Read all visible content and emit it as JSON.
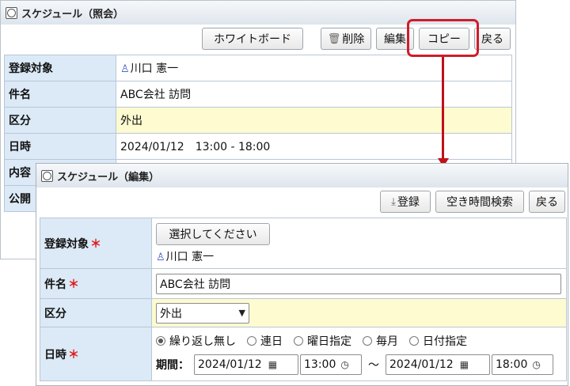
{
  "view_panel": {
    "title": "スケジュール（照会）",
    "buttons": {
      "whiteboard": "ホワイトボード",
      "delete": "削除",
      "edit": "編集",
      "copy": "コピー",
      "back": "戻る"
    },
    "rows": {
      "target_label": "登録対象",
      "target_value": "川口 憲一",
      "subject_label": "件名",
      "subject_value": "ABC会社 訪問",
      "category_label": "区分",
      "category_value": "外出",
      "datetime_label": "日時",
      "datetime_value": "2024/01/12　13:00 - 18:00",
      "content_label": "内容",
      "public_label": "公開"
    }
  },
  "edit_panel": {
    "title": "スケジュール（編集）",
    "buttons": {
      "register": "登録",
      "free_time_search": "空き時間検索",
      "back": "戻る"
    },
    "rows": {
      "target_label": "登録対象",
      "select_button": "選択してください",
      "target_value": "川口 憲一",
      "subject_label": "件名",
      "subject_value": "ABC会社 訪問",
      "category_label": "区分",
      "category_value": "外出",
      "datetime_label": "日時",
      "repeat_options": [
        "繰り返し無し",
        "連日",
        "曜日指定",
        "毎月",
        "日付指定"
      ],
      "period_label": "期間：",
      "start_date": "2024/01/12",
      "start_time": "13:00",
      "tilde": "～",
      "end_date": "2024/01/12",
      "end_time": "18:00"
    },
    "required_mark": "＊"
  },
  "colors": {
    "label_bg": "#dce9f6",
    "highlight_bg": "#fdfbcf",
    "annotation_red": "#cf1d2a"
  }
}
